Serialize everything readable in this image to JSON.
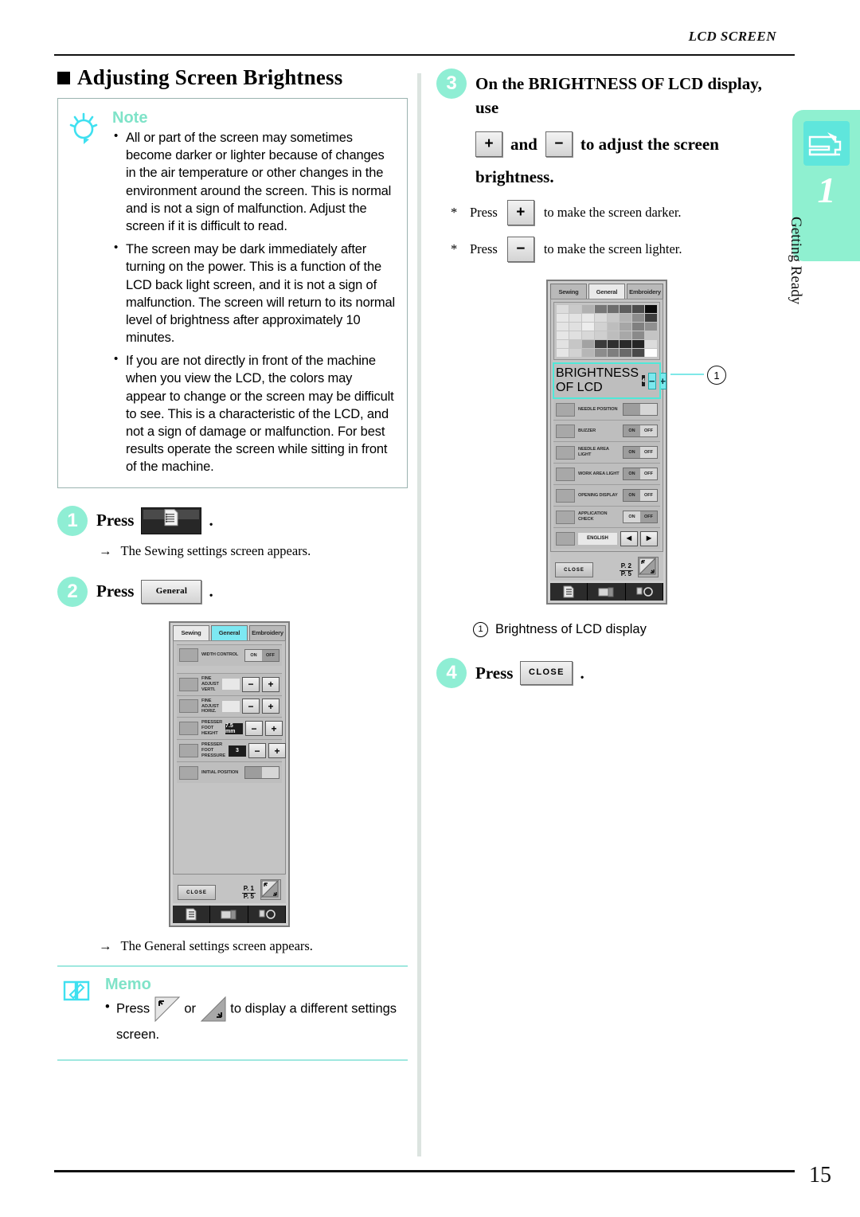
{
  "header": {
    "running_title": "LCD SCREEN"
  },
  "side_tab": {
    "chapter_number": "1",
    "chapter_label": "Getting Ready",
    "icon": "sewing-machine-icon"
  },
  "footer": {
    "page_number": "15"
  },
  "left": {
    "section_title": "Adjusting Screen Brightness",
    "note": {
      "title": "Note",
      "icon": "lightbulb-icon",
      "bullets": [
        "All or part of the screen may sometimes become darker or lighter because of changes in the air temperature or other changes in the environment around the screen. This is normal and is not a sign of malfunction. Adjust the screen if it is difficult to read.",
        "The screen may be dark immediately after turning on the power. This is a function of the LCD back light screen, and it is not a sign of malfunction. The screen will return to its normal level of brightness after approximately 10 minutes.",
        "If you are not directly in front of the machine when you view the LCD, the colors may appear to change or the screen may be difficult to see. This is a characteristic of the LCD, and not a sign of damage or malfunction. For best results operate the screen while sitting in front of the machine."
      ]
    },
    "step1": {
      "number": "1",
      "press_label": "Press",
      "button_icon": "settings-page-icon",
      "period": ".",
      "result_arrow": "→",
      "result": "The Sewing settings screen appears."
    },
    "step2": {
      "number": "2",
      "press_label": "Press",
      "button_label": "General",
      "period": ".",
      "result_arrow": "→",
      "result": "The General settings screen appears."
    },
    "lcd_general": {
      "tabs": [
        "Sewing",
        "General",
        "Embroidery"
      ],
      "active_tab": "General",
      "rows": [
        {
          "label": "WIDTH CONTROL",
          "control": "onoff",
          "on": "ON",
          "off": "OFF",
          "selected": "OFF"
        },
        {
          "label": "FINE ADJUST VERTI.",
          "control": "pm",
          "value": "",
          "minus": "−",
          "plus": "+"
        },
        {
          "label": "FINE ADJUST HORIZ.",
          "control": "pm",
          "value": "",
          "minus": "−",
          "plus": "+"
        },
        {
          "label": "PRESSER FOOT HEIGHT",
          "control": "pm",
          "value": "7.5 mm",
          "minus": "−",
          "plus": "+"
        },
        {
          "label": "PRESSER FOOT PRESSURE",
          "control": "pm",
          "value": "3",
          "minus": "−",
          "plus": "+"
        },
        {
          "label": "INITIAL POSITION",
          "control": "pair"
        }
      ],
      "close_label": "CLOSE",
      "page_current": "P. 1",
      "page_total": "P. 5"
    },
    "memo": {
      "title": "Memo",
      "icon": "memo-book-icon",
      "text_before": "Press",
      "text_or": "or",
      "text_after": "to display a different settings screen.",
      "btn_prev_icon": "prev-screen-triangle-icon",
      "btn_next_icon": "next-screen-triangle-icon"
    }
  },
  "right": {
    "step3": {
      "number": "3",
      "line1": "On the BRIGHTNESS OF LCD display, use",
      "key_plus": "+",
      "and_label": "and",
      "key_minus": "−",
      "line2_tail": "to adjust the screen",
      "line3": "brightness.",
      "notes": [
        {
          "star": "*",
          "press": "Press",
          "key": "+",
          "tail": "to make the screen darker."
        },
        {
          "star": "*",
          "press": "Press",
          "key": "−",
          "tail": "to make the screen lighter."
        }
      ]
    },
    "lcd_brightness": {
      "tabs": [
        "Sewing",
        "General",
        "Embroidery"
      ],
      "active_tab": "General",
      "grayscale_grid": {
        "columns": 8,
        "rows": 6,
        "cells": [
          "#dcdcdc",
          "#c9c9c9",
          "#b1b1b1",
          "#767676",
          "#6d6d6d",
          "#5e5e5e",
          "#4c4c4c",
          "#0a0a0a",
          "#e6e6e6",
          "#e2e2e2",
          "#e8e8e8",
          "#dadada",
          "#c8c8c8",
          "#b4b4b4",
          "#8d8d8d",
          "#3d3d3d",
          "#e4e4e4",
          "#e0e0e0",
          "#ededed",
          "#d2d2d2",
          "#bdbdbd",
          "#a6a6a6",
          "#808080",
          "#909090",
          "#e6e6e6",
          "#e0e0e0",
          "#d8d8d8",
          "#cfcfcf",
          "#bdbdbd",
          "#a8a8a8",
          "#8a8a8a",
          "#c4c4c4",
          "#e2e2e2",
          "#c6c6c6",
          "#a2a2a2",
          "#3b3b3b",
          "#2f2f2f",
          "#2a2a2a",
          "#242424",
          "#dcdcdc",
          "#e6e6e6",
          "#d2d2d2",
          "#b6b6b6",
          "#8c8c8c",
          "#7e7e7e",
          "#6a6a6a",
          "#4a4a4a",
          "#fdfdfd"
        ]
      },
      "brightness_row": {
        "label": "BRIGHTNESS OF LCD",
        "value": "4",
        "minus": "−",
        "plus": "+"
      },
      "rows": [
        {
          "label": "NEEDLE POSITION",
          "control": "pair"
        },
        {
          "label": "BUZZER",
          "control": "onoff",
          "on": "ON",
          "off": "OFF",
          "selected": "ON"
        },
        {
          "label": "NEEDLE AREA LIGHT",
          "control": "onoff",
          "on": "ON",
          "off": "OFF",
          "selected": "ON"
        },
        {
          "label": "WORK AREA LIGHT",
          "control": "onoff",
          "on": "ON",
          "off": "OFF",
          "selected": "ON"
        },
        {
          "label": "OPENING DISPLAY",
          "control": "onoff",
          "on": "ON",
          "off": "OFF",
          "selected": "ON"
        },
        {
          "label": "APPLICATION CHECK",
          "control": "onoff",
          "on": "ON",
          "off": "OFF",
          "selected": "OFF"
        },
        {
          "label": "",
          "control": "lang",
          "value": "ENGLISH",
          "prev": "◀",
          "next": "▶"
        }
      ],
      "close_label": "CLOSE",
      "page_current": "P. 2",
      "page_total": "P. 5",
      "callout_number": "①"
    },
    "callout_caption": {
      "number": "①",
      "text": "Brightness of LCD display"
    },
    "step4": {
      "number": "4",
      "press_label": "Press",
      "button_label": "CLOSE",
      "period": "."
    }
  },
  "colors": {
    "accent_mint": "#8FEED4",
    "accent_cyan": "#5FE6DC",
    "caption_green": "#7FE3C8",
    "note_border": "#9BB3B0",
    "lcd_bg": "#C4C4C4"
  }
}
